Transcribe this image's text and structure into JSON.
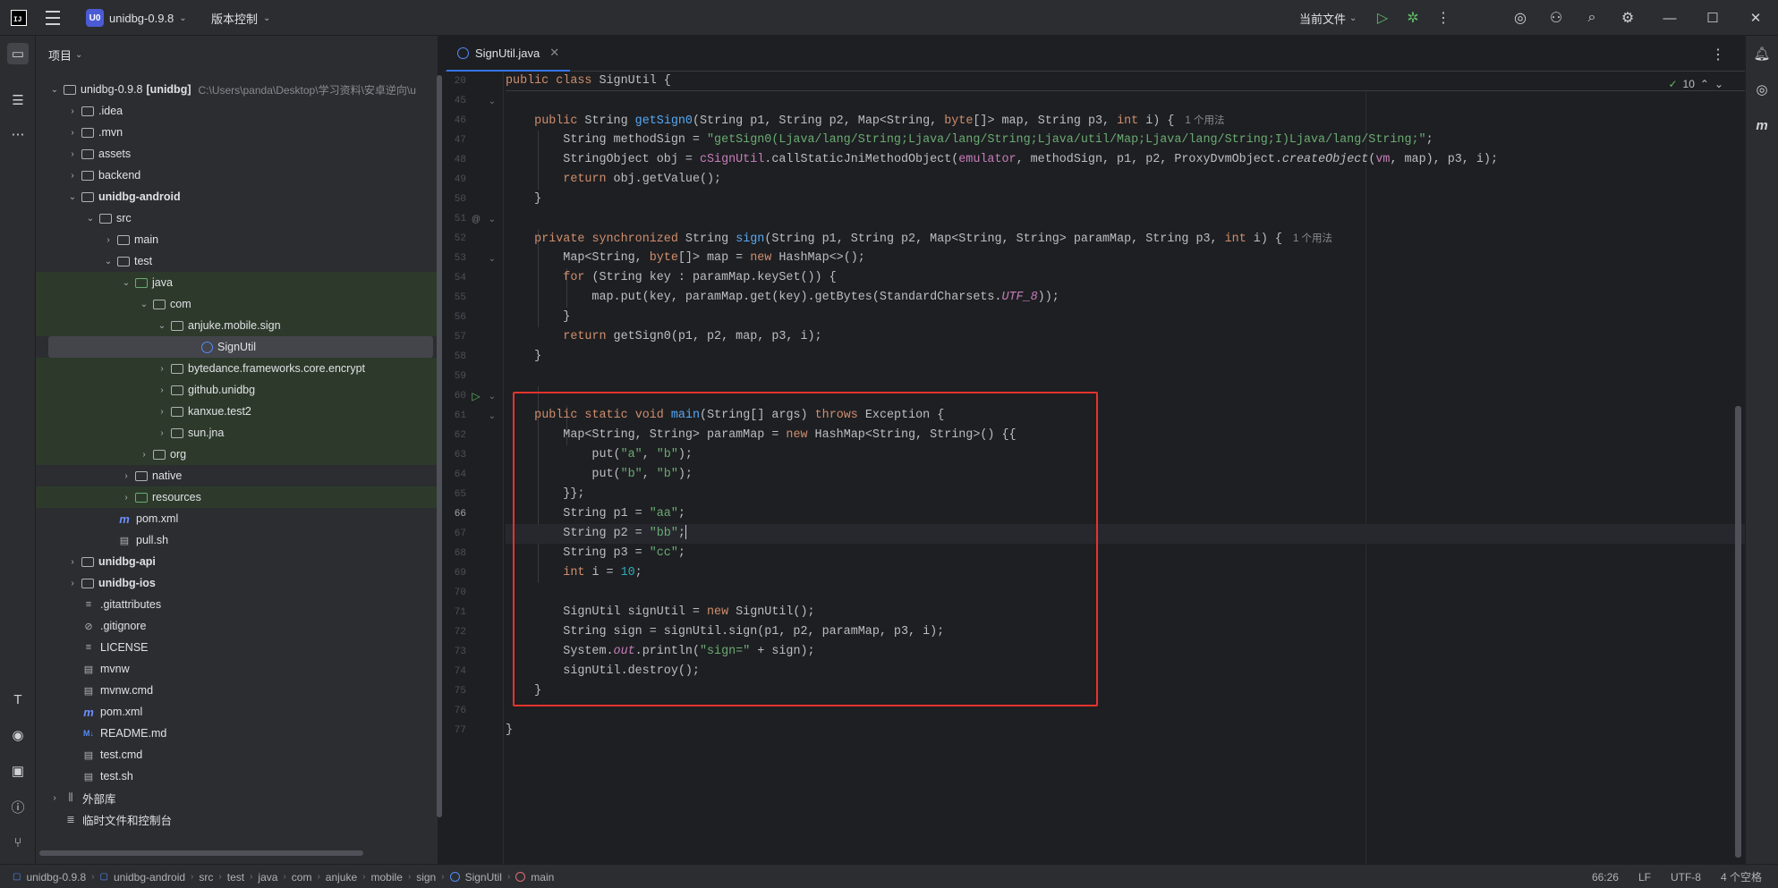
{
  "titlebar": {
    "logo": "IJ",
    "project_badge": "U0",
    "project_name": "unidbg-0.9.8",
    "vcs_label": "版本控制",
    "run_config": "当前文件"
  },
  "icons": {
    "run": "play-icon",
    "debug": "bug-icon",
    "more": "more-vertical-icon",
    "ai": "ai-assistant-icon",
    "add_user": "add-user-icon",
    "search": "search-icon",
    "settings": "gear-icon"
  },
  "project_panel": {
    "title": "项目",
    "root_name": "unidbg-0.9.8",
    "root_module": "[unidbg]",
    "root_path": "C:\\Users\\panda\\Desktop\\学习资料\\安卓逆向\\u",
    "items": [
      {
        "label": ".idea"
      },
      {
        "label": ".mvn"
      },
      {
        "label": "assets"
      },
      {
        "label": "backend"
      },
      {
        "label": "unidbg-android"
      },
      {
        "label": "src"
      },
      {
        "label": "main"
      },
      {
        "label": "test"
      },
      {
        "label": "java"
      },
      {
        "label": "com"
      },
      {
        "label": "anjuke.mobile.sign"
      },
      {
        "label": "SignUtil"
      },
      {
        "label": "bytedance.frameworks.core.encrypt"
      },
      {
        "label": "github.unidbg"
      },
      {
        "label": "kanxue.test2"
      },
      {
        "label": "sun.jna"
      },
      {
        "label": "org"
      },
      {
        "label": "native"
      },
      {
        "label": "resources"
      },
      {
        "label": "pom.xml"
      },
      {
        "label": "pull.sh"
      },
      {
        "label": "unidbg-api"
      },
      {
        "label": "unidbg-ios"
      },
      {
        "label": ".gitattributes"
      },
      {
        "label": ".gitignore"
      },
      {
        "label": "LICENSE"
      },
      {
        "label": "mvnw"
      },
      {
        "label": "mvnw.cmd"
      },
      {
        "label": "pom.xml"
      },
      {
        "label": "README.md"
      },
      {
        "label": "test.cmd"
      },
      {
        "label": "test.sh"
      },
      {
        "label": "外部库"
      },
      {
        "label": "临时文件和控制台"
      }
    ]
  },
  "editor": {
    "tab_label": "SignUtil.java",
    "inspections_count": "10",
    "usage_hint": "1 个用法",
    "line_numbers": [
      "20",
      "45",
      "46",
      "47",
      "48",
      "49",
      "50",
      "51",
      "52",
      "53",
      "54",
      "55",
      "56",
      "57",
      "58",
      "59",
      "60",
      "61",
      "62",
      "63",
      "64",
      "65",
      "66",
      "67",
      "68",
      "69",
      "70",
      "71",
      "72",
      "73",
      "74",
      "75",
      "76",
      "77"
    ],
    "current_line": "66"
  },
  "statusbar": {
    "crumbs": [
      "unidbg-0.9.8",
      "unidbg-android",
      "src",
      "test",
      "java",
      "com",
      "anjuke",
      "mobile",
      "sign",
      "SignUtil",
      "main"
    ],
    "position": "66:26",
    "line_sep": "LF",
    "encoding": "UTF-8",
    "indent": "4 个空格"
  }
}
